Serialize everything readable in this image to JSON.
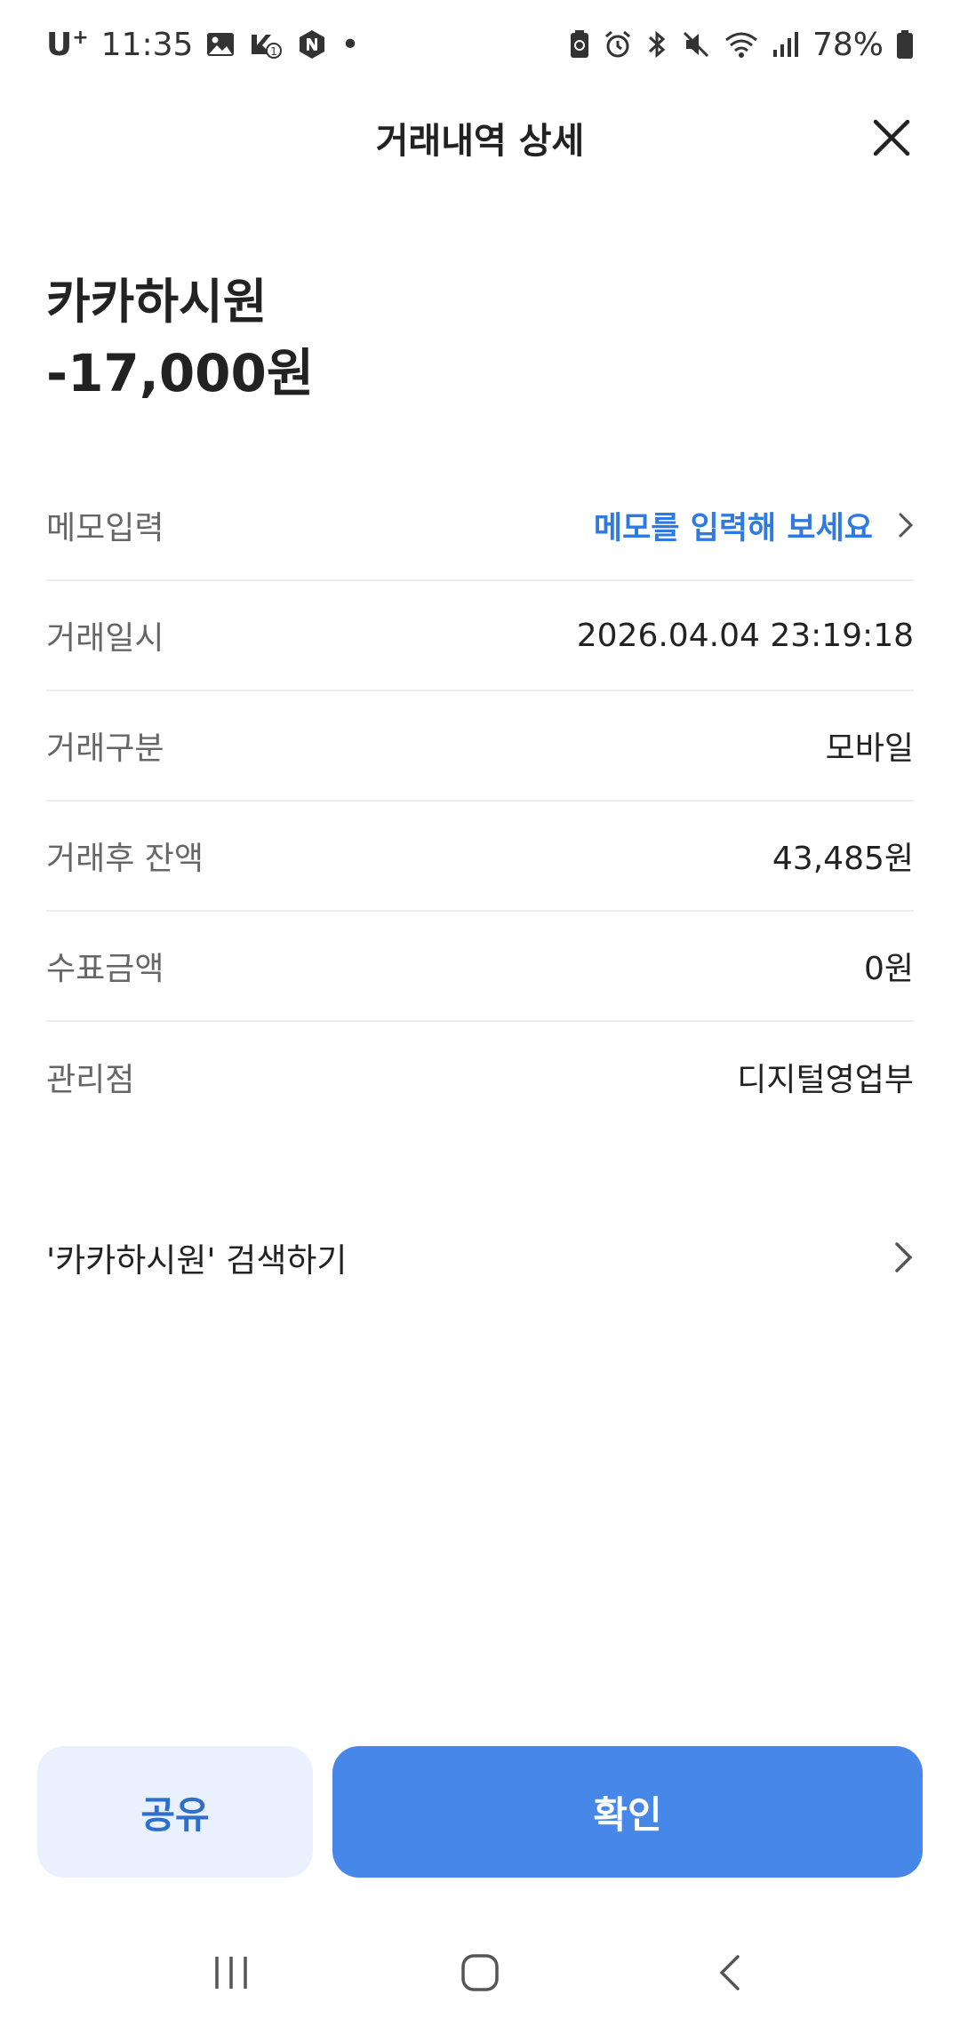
{
  "status_bar": {
    "carrier": "U",
    "carrier_plus": "+",
    "time": "11:35",
    "dot": "•",
    "battery": "78%"
  },
  "header": {
    "title": "거래내역 상세"
  },
  "summary": {
    "merchant": "카카하시원",
    "amount": "-17,000원"
  },
  "details": {
    "memo_label": "메모입력",
    "memo_placeholder": "메모를 입력해 보세요",
    "date_label": "거래일시",
    "date_value": "2026.04.04 23:19:18",
    "type_label": "거래구분",
    "type_value": "모바일",
    "balance_label": "거래후 잔액",
    "balance_value": "43,485원",
    "check_label": "수표금액",
    "check_value": "0원",
    "branch_label": "관리점",
    "branch_value": "디지털영업부"
  },
  "search": {
    "label": "'카카하시원' 검색하기"
  },
  "buttons": {
    "share": "공유",
    "confirm": "확인"
  },
  "colors": {
    "accent_blue": "#4787e8",
    "link_blue": "#2e7ae0",
    "share_bg": "#e8f1fd"
  }
}
